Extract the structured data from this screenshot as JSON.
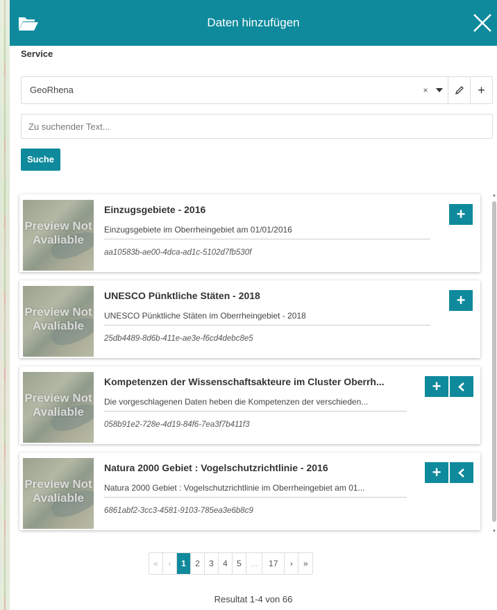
{
  "header": {
    "title": "Daten hinzufügen",
    "icon": "folder-open-icon",
    "close_icon": "close-icon"
  },
  "service": {
    "label": "Service",
    "selected": "GeoRhena",
    "clear_symbol": "×",
    "edit_symbol": "✎",
    "add_symbol": "+"
  },
  "search": {
    "placeholder": "Zu suchender Text...",
    "value": "",
    "button_label": "Suche"
  },
  "results": [
    {
      "title": "Einzugsgebiete - 2016",
      "description": "Einzugsgebiete im Oberrheingebiet am 01/01/2016",
      "id": "aa10583b-ae00-4dca-ad1c-5102d7fb530f",
      "thumbnail": "Preview Not Avaliable",
      "actions": [
        "add"
      ]
    },
    {
      "title": "UNESCO Pünktliche Stäten - 2018",
      "description": "UNESCO Pünktliche Stäten im Oberrheingebiet - 2018",
      "id": "25db4489-8d6b-411e-ae3e-f6cd4debc8e5",
      "thumbnail": "Preview Not Avaliable",
      "actions": [
        "add"
      ]
    },
    {
      "title": "Kompetenzen der Wissenschaftsakteure im Cluster Oberrh...",
      "description": "Die vorgeschlagenen Daten heben die Kompetenzen der verschieden...",
      "id": "058b91e2-728e-4d19-84f6-7ea3f7b411f3",
      "thumbnail": "Preview Not Avaliable",
      "actions": [
        "add",
        "expand"
      ]
    },
    {
      "title": "Natura 2000 Gebiet : Vogelschutzrichtlinie - 2016",
      "description": "Natura 2000 Gebiet : Vogelschutzrichtlinie im Oberrheingebiet am 01...",
      "id": "6861abf2-3cc3-4581-9103-785ea3e6b8c9",
      "thumbnail": "Preview Not Avaliable",
      "actions": [
        "add",
        "expand"
      ]
    }
  ],
  "pagination": {
    "first": "«",
    "prev": "‹",
    "pages": [
      "1",
      "2",
      "3",
      "4",
      "5",
      "...",
      "17"
    ],
    "active": "1",
    "next": "›",
    "last": "»"
  },
  "result_count": "Resultat 1-4 von 66",
  "colors": {
    "accent": "#0e8a9c"
  }
}
